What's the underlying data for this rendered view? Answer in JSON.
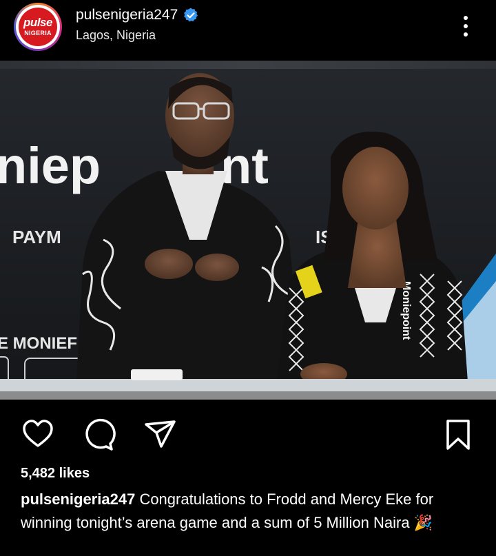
{
  "post": {
    "username": "pulsenigeria247",
    "location": "Lagos, Nigeria",
    "likes": "5,482 likes",
    "caption_user": "pulsenigeria247",
    "caption_text": "Congratulations to Frodd and Mercy Eke for winning tonight’s arena game and a sum of 5 Million Naira",
    "caption_emoji": "🎉"
  },
  "avatar": {
    "logo_top": "pulse",
    "logo_bottom": "NIGERIA"
  },
  "photo": {
    "sign_big": "niep",
    "sign_big_2": "nt",
    "sign_pay": "PAYM",
    "sign_is": "IS",
    "sign_monie": "E MONIEF",
    "shirt_text": "Moniepoint"
  },
  "icons": {
    "like": "heart-icon",
    "comment": "comment-icon",
    "share": "paper-plane-icon",
    "save": "bookmark-icon",
    "more": "more-vertical-icon",
    "verified": "verified-badge-icon"
  },
  "colors": {
    "background": "#000000",
    "verified": "#3897f0",
    "brand": "#d71920"
  }
}
